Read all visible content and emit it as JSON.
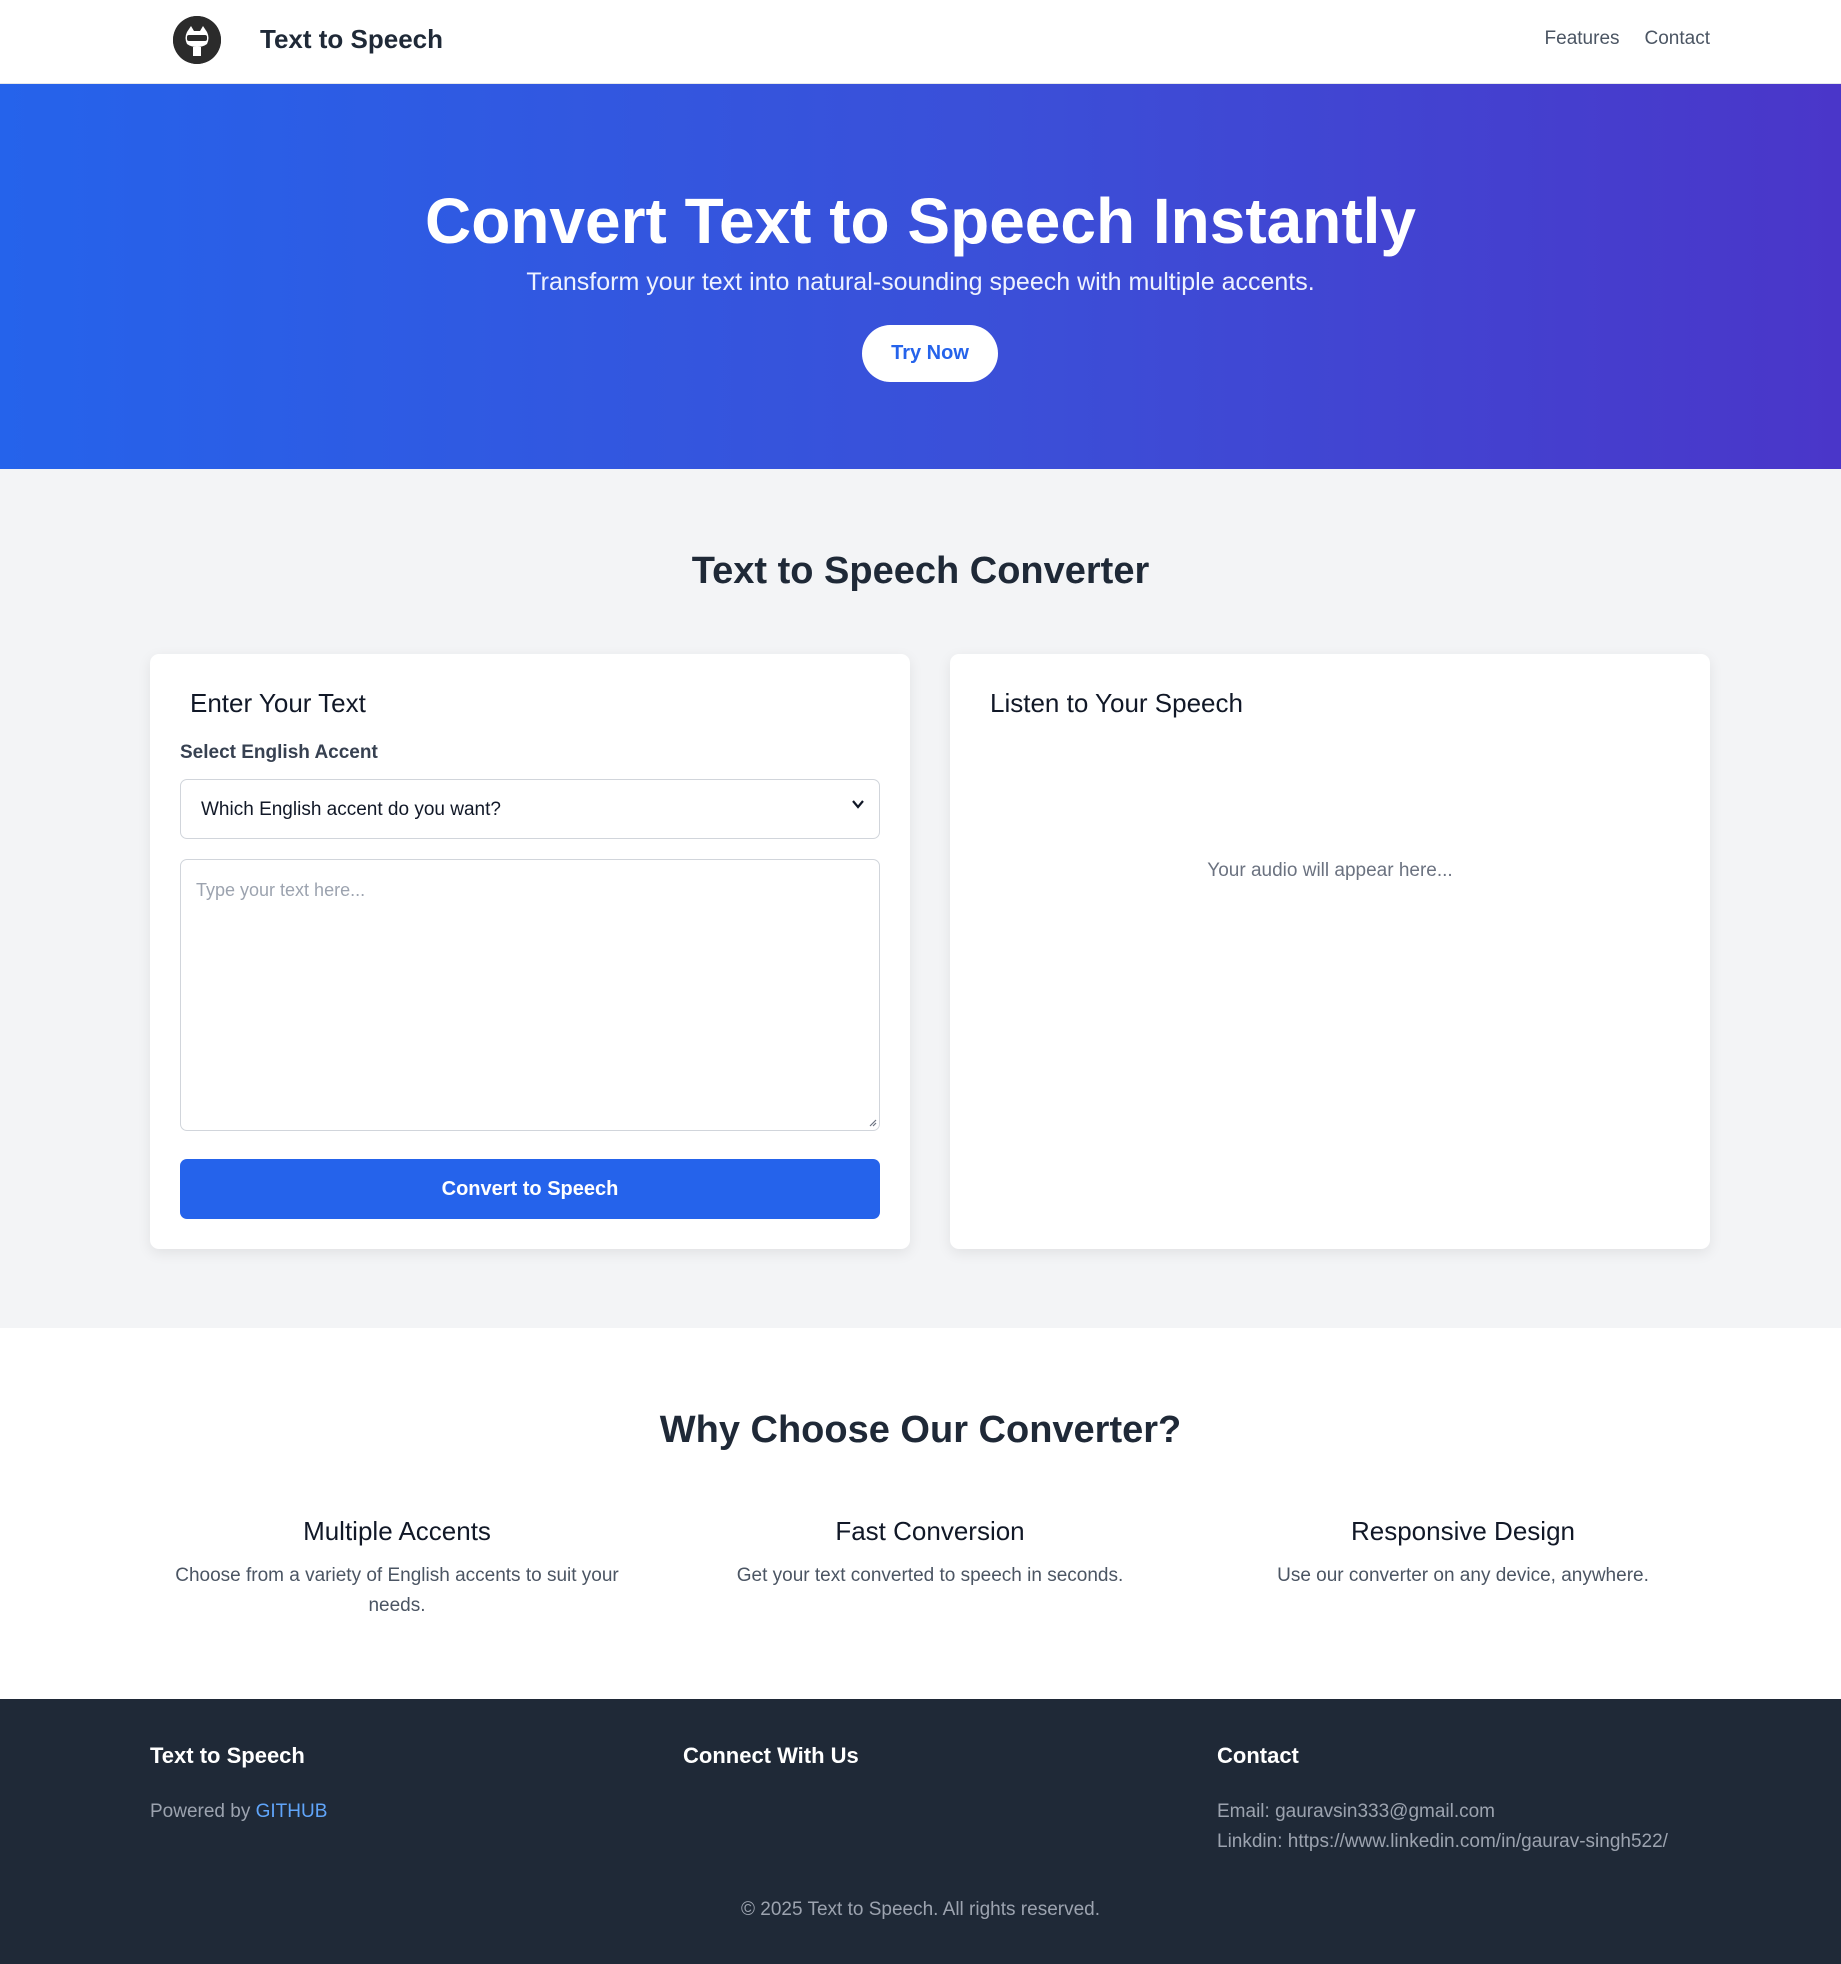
{
  "nav": {
    "brand": "Text to Speech",
    "links": [
      "Features",
      "Contact"
    ]
  },
  "hero": {
    "title": "Convert Text to Speech Instantly",
    "subtitle": "Transform your text into natural-sounding speech with multiple accents.",
    "cta": "Try Now"
  },
  "converter": {
    "title": "Text to Speech Converter",
    "input_card": {
      "title": "Enter Your Text",
      "accent_label": "Select English Accent",
      "accent_selected": "Which English accent do you want?",
      "text_placeholder": "Type your text here...",
      "convert_button": "Convert to Speech"
    },
    "output_card": {
      "title": "Listen to Your Speech",
      "placeholder": "Your audio will appear here..."
    }
  },
  "features": {
    "title": "Why Choose Our Converter?",
    "items": [
      {
        "title": "Multiple Accents",
        "desc": "Choose from a variety of English accents to suit your needs."
      },
      {
        "title": "Fast Conversion",
        "desc": "Get your text converted to speech in seconds."
      },
      {
        "title": "Responsive Design",
        "desc": "Use our converter on any device, anywhere."
      }
    ]
  },
  "footer": {
    "brand": {
      "title": "Text to Speech",
      "powered_prefix": "Powered by ",
      "powered_link": "GITHUB"
    },
    "connect": {
      "title": "Connect With Us"
    },
    "contact": {
      "title": "Contact",
      "email": "Email: gauravsin333@gmail.com",
      "linkedin": "Linkdin: https://www.linkedin.com/in/gaurav-singh522/"
    },
    "copyright": "© 2025 Text to Speech. All rights reserved."
  },
  "colors": {
    "primary": "#2563eb",
    "hero_gradient_end": "#4a36c9",
    "section_bg": "#f3f4f6",
    "footer_bg": "#1f2937",
    "link": "#60a5fa"
  },
  "icons": {
    "logo": "github-octocat-icon",
    "select_arrow": "chevron-down-icon",
    "resize": "resize-grip-icon"
  }
}
